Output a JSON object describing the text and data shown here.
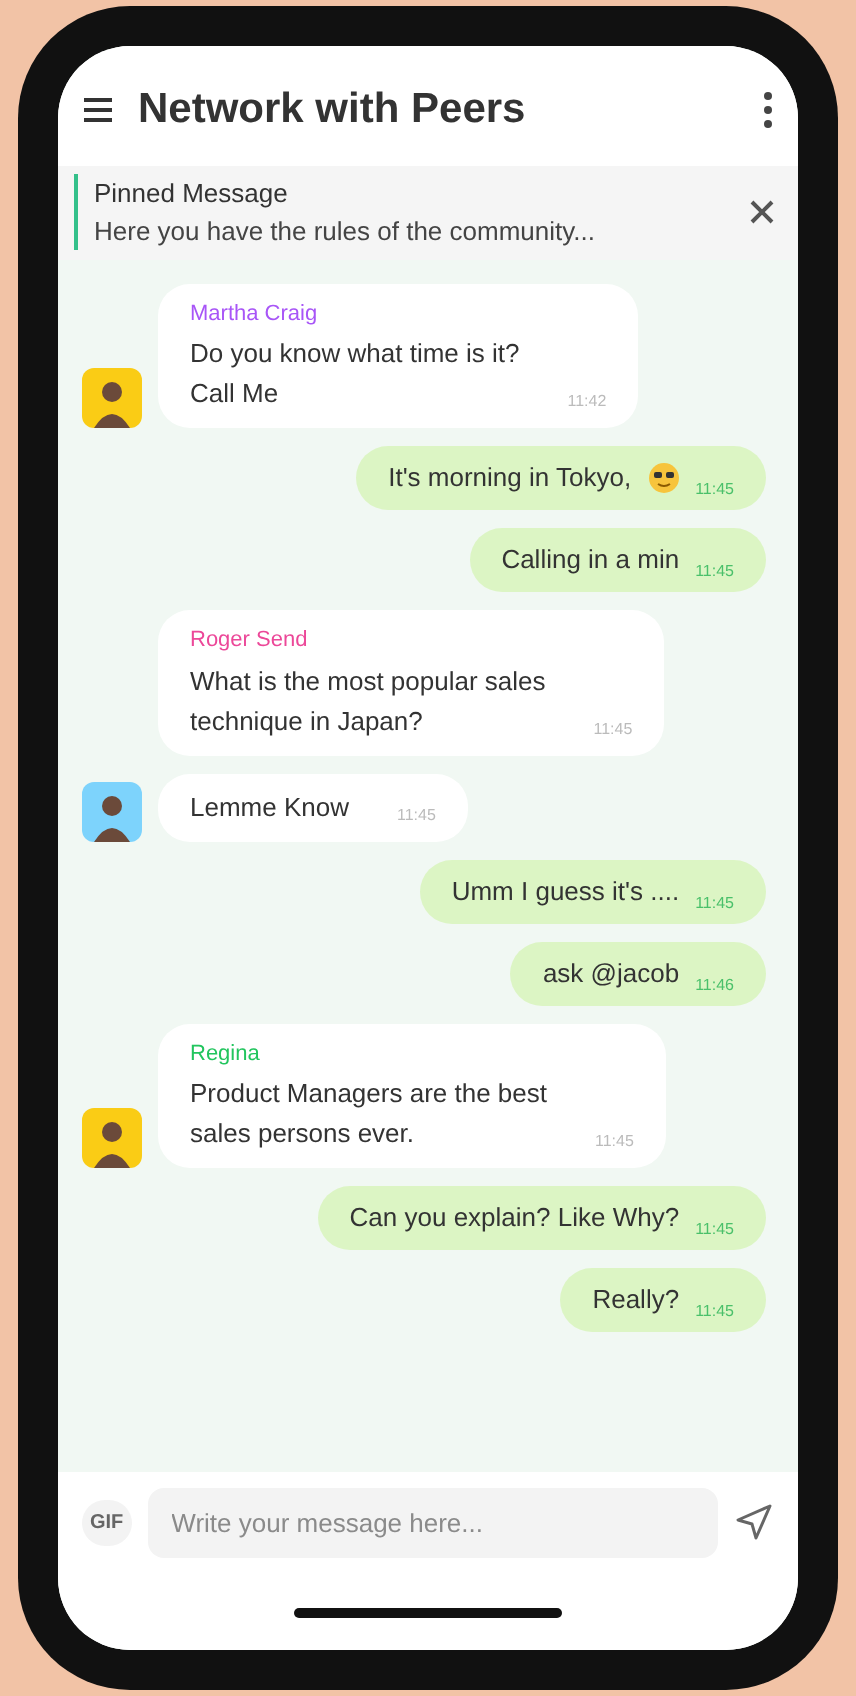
{
  "header": {
    "title": "Network with Peers"
  },
  "pinned": {
    "label": "Pinned Message",
    "text": "Here you have the rules of the community..."
  },
  "messages": [
    {
      "kind": "incoming",
      "sender": "Martha Craig",
      "color": "#a855f7",
      "avatar": true,
      "lines": [
        "Do you know what time is it?",
        "Call Me"
      ],
      "time": "11:42"
    },
    {
      "kind": "outgoing",
      "lines": [
        "It's morning in Tokyo,"
      ],
      "emoji": true,
      "time": "11:45"
    },
    {
      "kind": "outgoing",
      "lines": [
        "Calling in a min"
      ],
      "emoji": false,
      "time": "11:45"
    },
    {
      "kind": "incoming",
      "sender": "Roger Send",
      "color": "#ec4899",
      "avatar": false,
      "lines": [
        "What is the most popular sales",
        "technique in Japan?"
      ],
      "time": "11:45"
    },
    {
      "kind": "incoming",
      "avatar": true,
      "lines": [
        "Lemme Know"
      ],
      "time": "11:45"
    },
    {
      "kind": "outgoing",
      "lines": [
        "Umm I guess it's ...."
      ],
      "emoji": false,
      "time": "11:45"
    },
    {
      "kind": "outgoing",
      "lines": [
        "ask @jacob"
      ],
      "emoji": false,
      "time": "11:46"
    },
    {
      "kind": "incoming",
      "sender": "Regina",
      "color": "#22c55e",
      "avatar": true,
      "lines": [
        "Product Managers are the best",
        "sales persons ever."
      ],
      "time": "11:45"
    },
    {
      "kind": "outgoing",
      "lines": [
        "Can you explain? Like Why?"
      ],
      "emoji": false,
      "time": "11:45"
    },
    {
      "kind": "outgoing",
      "lines": [
        "Really?"
      ],
      "emoji": false,
      "time": "11:45"
    }
  ],
  "composer": {
    "gif_label": "GIF",
    "placeholder": "Write your message here..."
  }
}
